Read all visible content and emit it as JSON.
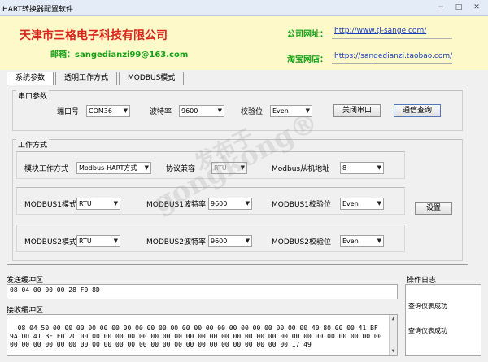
{
  "window": {
    "title": "HART转换器配置软件",
    "minimize": "−",
    "maximize": "□",
    "close": "✕"
  },
  "banner": {
    "company": "天津市三格电子科技有限公司",
    "email": "邮箱：sangedianzi99@163.com",
    "website_label": "公司网址：",
    "website_url": "http://www.tj-sange.com/",
    "shop_label": "淘宝网店：",
    "shop_url": "https://sangedianzi.taobao.com/"
  },
  "tabs": [
    "系统参数",
    "透明工作方式",
    "MODBUS模式"
  ],
  "serial": {
    "group_title": "串口参数",
    "port_label": "端口号",
    "port_value": "COM36",
    "baud_label": "波特率",
    "baud_value": "9600",
    "parity_label": "校验位",
    "parity_value": "Even",
    "close_port_button": "关闭串口",
    "comm_query_button": "通信查询"
  },
  "work": {
    "group_title": "工作方式",
    "mode_label": "模块工作方式",
    "mode_value": "Modbus-HART方式",
    "protocol_label": "协议兼容",
    "protocol_value": "RTU",
    "slave_label": "Modbus从机地址",
    "slave_value": "8",
    "m1_mode_label": "MODBUS1模式",
    "m1_mode_value": "RTU",
    "m1_baud_label": "MODBUS1波特率",
    "m1_baud_value": "9600",
    "m1_parity_label": "MODBUS1校验位",
    "m1_parity_value": "Even",
    "set_button": "设置",
    "m2_mode_label": "MODBUS2模式",
    "m2_mode_value": "RTU",
    "m2_baud_label": "MODBUS2波特率",
    "m2_baud_value": "9600",
    "m2_parity_label": "MODBUS2校验位",
    "m2_parity_value": "Even"
  },
  "buffers": {
    "send_label": "发送缓冲区",
    "send_value": "08 04 00 00 00 28 F0 8D",
    "recv_label": "接收缓冲区",
    "recv_value": "08 04 50 00 00 00 00 00 00 00 00 00 00 00 00 00 00 00 00 00 00 00 00 00 00 40 80 00 00 41 BF 9A DD 41 BF F0 2C 00 00 00 00 00 00 00 00 00 00 00 00 00 00 00 00 00 00 00 00 00 00 00 00 00 00 00 00 00 00 00 00 00 00 00 00 00 00 00 00 00 00 00 00 00 00 00 00 00 00 17 49",
    "log_label": "操作日志",
    "log_lines": [
      "查询仪表成功",
      "查询仪表成功"
    ]
  },
  "watermark": {
    "line1": "发布于",
    "line2": "gongkong®"
  }
}
